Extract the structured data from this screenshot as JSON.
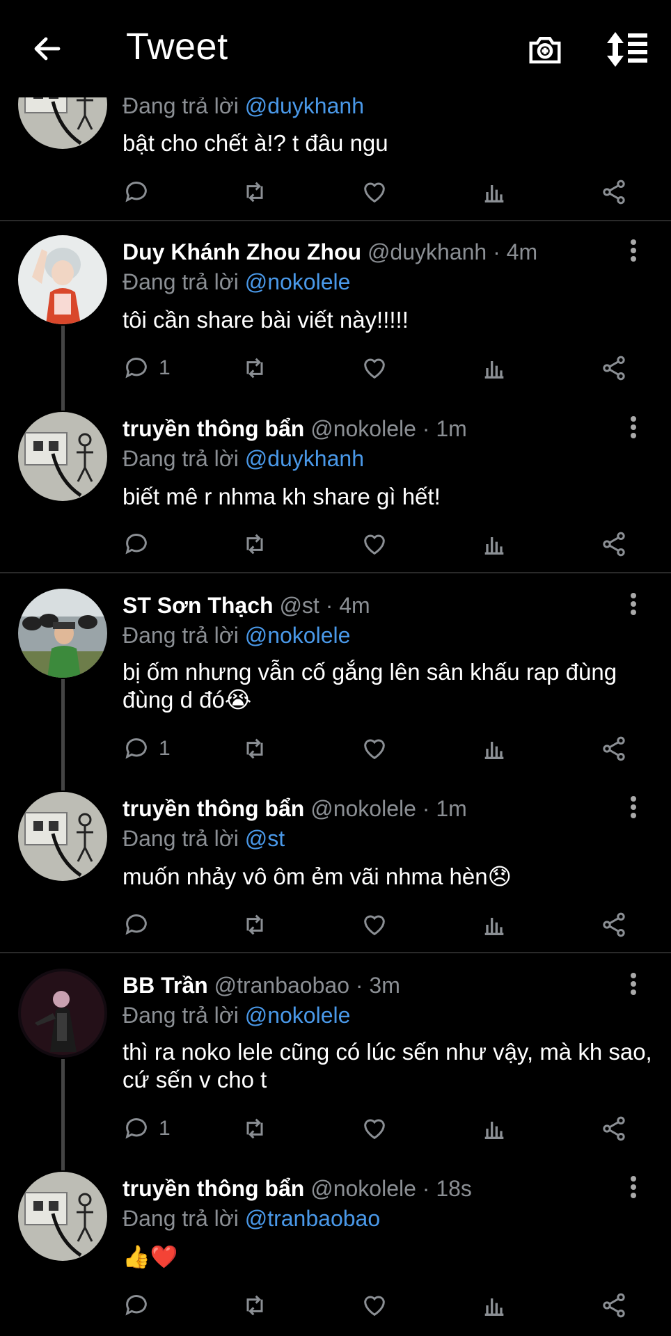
{
  "header": {
    "title": "Tweet",
    "back_icon": "arrow-left-icon",
    "camera_icon": "camera-plus-icon",
    "sort_icon": "sort-icon"
  },
  "colors": {
    "bg": "#000000",
    "muted": "#8b8f94",
    "link": "#4a99e9",
    "line": "#444444"
  },
  "tweets": [
    {
      "name": "",
      "meta": "",
      "reply_prefix": "Đang trả lời",
      "reply_to": "@duykhanh",
      "text": "bật cho chết à!? t đâu ngu",
      "reply_count": ""
    },
    {
      "name": "Duy Khánh Zhou Zhou",
      "meta": "@duykhanh · 4m",
      "reply_prefix": "Đang trả lời",
      "reply_to": "@nokolele",
      "text": "tôi cần share bài viết này!!!!!",
      "reply_count": "1"
    },
    {
      "name": "truyền thông bẩn",
      "meta": "@nokolele · 1m",
      "reply_prefix": "Đang trả lời",
      "reply_to": "@duykhanh",
      "text": "biết mê r nhma kh share gì hết!",
      "reply_count": ""
    },
    {
      "name": "ST Sơn Thạch",
      "meta": "@st · 4m",
      "reply_prefix": "Đang trả lời",
      "reply_to": "@nokolele",
      "text": "bị ốm nhưng vẫn cố gắng lên sân khấu rap đùng đùng d đó😭",
      "reply_count": "1"
    },
    {
      "name": "truyền thông bẩn",
      "meta": "@nokolele · 1m",
      "reply_prefix": "Đang trả lời",
      "reply_to": "@st",
      "text": "muốn nhảy vô ôm ẻm vãi nhma hèn😞",
      "reply_count": ""
    },
    {
      "name": "BB Trần",
      "meta": "@tranbaobao · 3m",
      "reply_prefix": "Đang trả lời",
      "reply_to": "@nokolele",
      "text": "thì ra noko lele cũng có lúc sến như vậy, mà kh sao, cứ sến v cho t",
      "reply_count": "1"
    },
    {
      "name": "truyền thông bẩn",
      "meta": "@nokolele · 18s",
      "reply_prefix": "Đang trả lời",
      "reply_to": "@tranbaobao",
      "text": "👍❤️",
      "reply_count": ""
    }
  ]
}
